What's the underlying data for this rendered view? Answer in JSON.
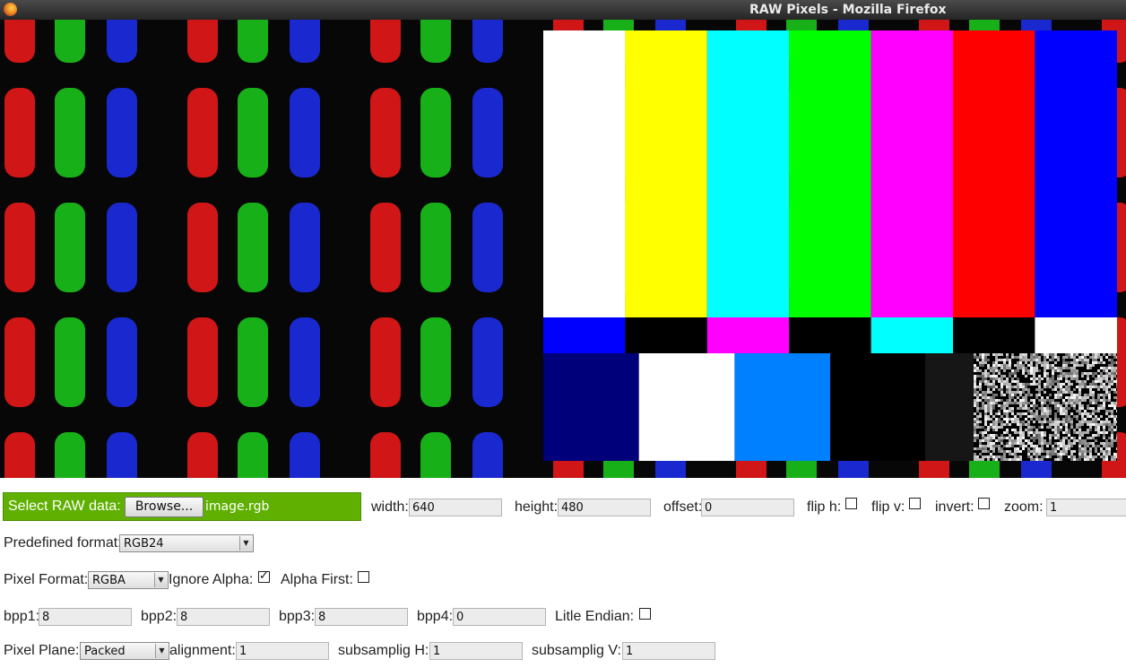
{
  "window": {
    "title": "RAW Pixels - Mozilla Firefox"
  },
  "controls": {
    "select_raw_label": "Select RAW data:",
    "browse_label": "Browse...",
    "file_name": "image.rgb",
    "width_label": "width:",
    "width_value": "640",
    "height_label": "height:",
    "height_value": "480",
    "offset_label": "offset:",
    "offset_value": "0",
    "flip_h_label": "flip h:",
    "flip_h_checked": false,
    "flip_v_label": "flip v:",
    "flip_v_checked": false,
    "invert_label": "invert:",
    "invert_checked": false,
    "zoom_label": "zoom:",
    "zoom_value": "1",
    "predefined_format_label": "Predefined format:",
    "predefined_format_value": "RGB24",
    "pixel_format_label": "Pixel Format:",
    "pixel_format_value": "RGBA",
    "ignore_alpha_label": "Ignore Alpha:",
    "ignore_alpha_checked": true,
    "alpha_first_label": "Alpha First:",
    "alpha_first_checked": false,
    "bpp1_label": "bpp1:",
    "bpp1_value": "8",
    "bpp2_label": "bpp2:",
    "bpp2_value": "8",
    "bpp3_label": "bpp3:",
    "bpp3_value": "8",
    "bpp4_label": "bpp4:",
    "bpp4_value": "0",
    "little_endian_label": "Litle Endian:",
    "little_endian_checked": false,
    "pixel_plane_label": "Pixel Plane:",
    "pixel_plane_value": "Packed",
    "alignment_label": "alignment:",
    "alignment_value": "1",
    "subsampling_h_label": "subsamplig H:",
    "subsampling_h_value": "1",
    "subsampling_v_label": "subsamplig V:",
    "subsampling_v_value": "1"
  },
  "colors": {
    "panel_green": "#5fb000",
    "bar_white": "#ffffff",
    "bar_yellow": "#ffff00",
    "bar_cyan": "#00ffff",
    "bar_green": "#00ff00",
    "bar_magenta": "#ff00ff",
    "bar_red": "#ff0000",
    "bar_blue": "#0000ff",
    "pluge_navy": "#00007a",
    "pluge_azure": "#0080ff"
  }
}
